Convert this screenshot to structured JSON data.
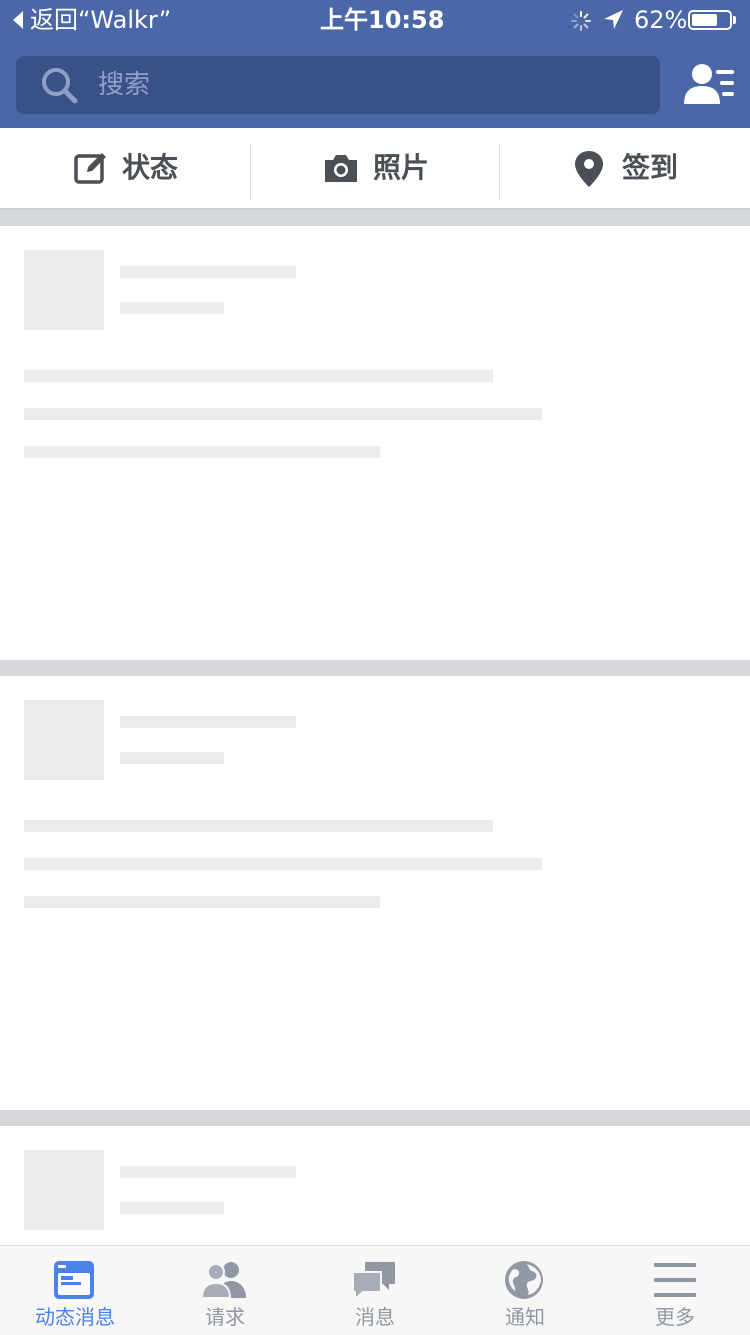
{
  "status_bar": {
    "back_text": "返回“Walkr”",
    "time": "上午10:58",
    "battery_percent": "62%",
    "battery_level": 0.62
  },
  "search": {
    "placeholder": "搜索"
  },
  "actions": [
    {
      "label": "状态",
      "icon": "compose-icon"
    },
    {
      "label": "照片",
      "icon": "camera-icon"
    },
    {
      "label": "签到",
      "icon": "location-pin-icon"
    }
  ],
  "tabs": [
    {
      "label": "动态消息",
      "icon": "news-feed-icon",
      "active": true
    },
    {
      "label": "请求",
      "icon": "friend-requests-icon",
      "active": false
    },
    {
      "label": "消息",
      "icon": "messages-icon",
      "active": false
    },
    {
      "label": "通知",
      "icon": "globe-icon",
      "active": false
    },
    {
      "label": "更多",
      "icon": "menu-icon",
      "active": false
    }
  ],
  "colors": {
    "brand_blue": "#4b67a8",
    "search_bg": "#3a5188",
    "active_tab": "#4b82e6",
    "inactive_tab": "#9197a3"
  }
}
